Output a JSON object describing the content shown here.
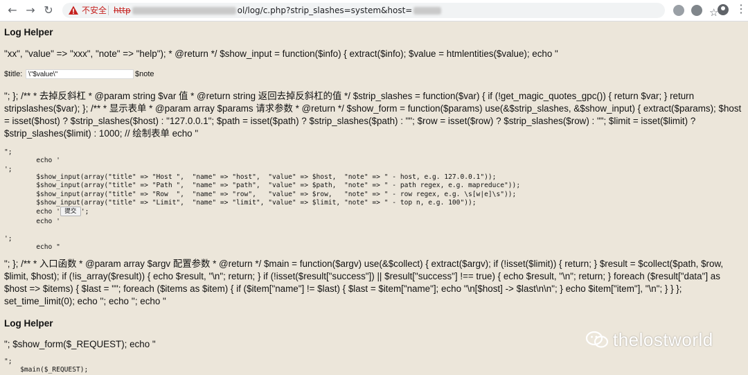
{
  "browser": {
    "back": "←",
    "forward": "→",
    "reload": "↻",
    "not_secure": "不安全",
    "url_scheme": "http",
    "url_mid": "ol/log/c.php?strip_slashes=system&host=",
    "star": "☆",
    "menu": "⋮"
  },
  "page": {
    "heading1": "Log Helper",
    "line1": "\"xx\", \"value\" => \"xxx\", \"note\" => \"help\"); * @return */ $show_input = function($info) { extract($info); $value = htmlentities($value); echo \"",
    "title_label": "$title:",
    "title_value": "\\\"$value\\\"",
    "note_label": "$note",
    "para2": "\"; }; /** * 去掉反斜杠 * @param string $var 值 * @return string 返回去掉反斜杠的值 */ $strip_slashes = function($var) { if (!get_magic_quotes_gpc()) { return $var; } return stripslashes($var); }; /** * 显示表单 * @param array $params 请求参数 * @return */ $show_form = function($params) use(&$strip_slashes, &$show_input) { extract($params); $host = isset($host) ? $strip_slashes($host) : \"127.0.0.1\"; $path = isset($path) ? $strip_slashes($path) : \"\"; $row = isset($row) ? $strip_slashes($row) : \"\"; $limit = isset($limit) ? $strip_slashes($limit) : 1000; // 绘制表单 echo \"",
    "code1": "\";\n        echo '\n';",
    "code2": "        $show_input(array(\"title\" => \"Host \",  \"name\" => \"host\",  \"value\" => $host,  \"note\" => \" - host, e.g. 127.0.0.1\"));\n        $show_input(array(\"title\" => \"Path \",  \"name\" => \"path\",  \"value\" => $path,  \"note\" => \" - path regex, e.g. mapreduce\"));\n        $show_input(array(\"title\" => \"Row  \",  \"name\" => \"row\",   \"value\" => $row,   \"note\" => \" - row regex, e.g. \\s[w|e]\\s\"));\n        $show_input(array(\"title\" => \"Limit\",  \"name\" => \"limit\", \"value\" => $limit, \"note\" => \" - top n, e.g. 100\"));",
    "echo_before_submit": "        echo '",
    "submit_label": "提交",
    "echo_after_submit": "';",
    "code3": "        echo '\n\n';\n        echo \"",
    "para3": "\"; }; /** * 入口函数 * @param array $argv 配置参数 * @return */ $main = function($argv) use(&$collect) { extract($argv); if (!isset($limit)) { return; } $result = $collect($path, $row, $limit, $host); if (!is_array($result)) { echo $result, \"\\n\"; return; } if (!isset($result[\"success\"]) || $result[\"success\"] !== true) { echo $result, \"\\n\"; return; } foreach ($result[\"data\"] as $host => $items) { $last = \"\"; foreach ($items as $item) { if ($item[\"name\"] != $last) { $last = $item[\"name\"]; echo \"\\n[$host] -> $last\\n\\n\"; } echo $item[\"item\"], \"\\n\"; } } }; set_time_limit(0); echo ''; echo ''; echo \"",
    "heading2": "Log Helper",
    "line4": "\"; $show_form($_REQUEST); echo \"",
    "code4": "\";\n    $main($_REQUEST);"
  },
  "watermark": "thelostworld",
  "colors": {
    "page_bg": "#ece6da",
    "warning_red": "#c5221f"
  }
}
